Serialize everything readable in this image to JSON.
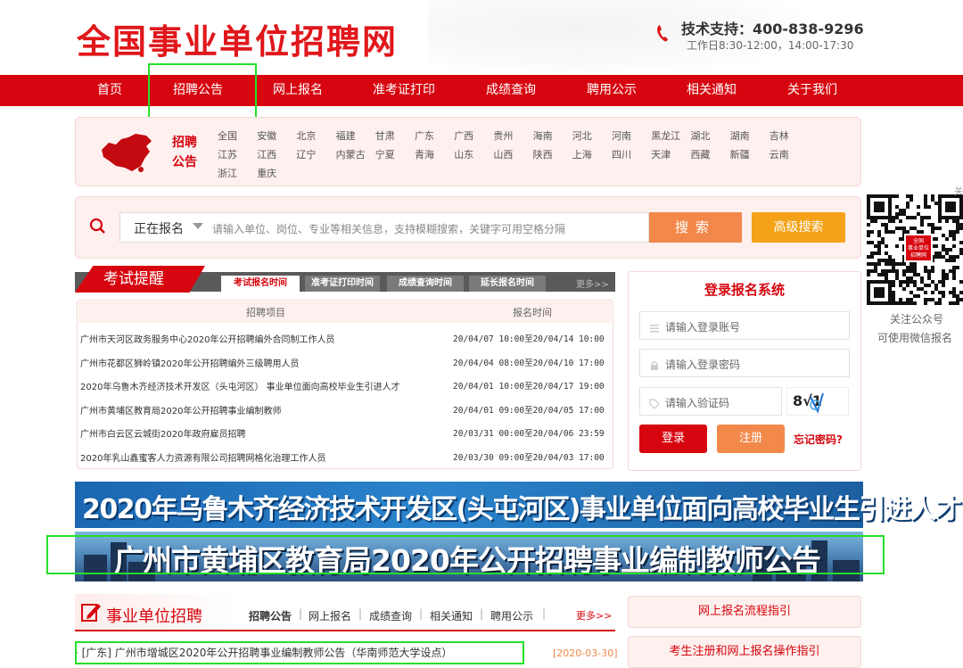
{
  "site": {
    "logo_text": "全国事业单位招聘网",
    "support": "技术支持：400-838-9296",
    "hours": "工作日8:30-12:00，14:00-17:30"
  },
  "nav": [
    "首页",
    "招聘公告",
    "网上报名",
    "准考证打印",
    "成绩查询",
    "聘用公示",
    "相关通知",
    "关于我们"
  ],
  "region": {
    "label": [
      "招聘",
      "公告"
    ],
    "provinces": [
      [
        "全国",
        "安徽",
        "北京",
        "福建",
        "甘肃",
        "广东",
        "广西",
        "贵州",
        "海南",
        "河北",
        "河南",
        "黑龙江",
        "湖北",
        "湖南",
        "吉林"
      ],
      [
        "江苏",
        "江西",
        "辽宁",
        "内蒙古",
        "宁夏",
        "青海",
        "山东",
        "山西",
        "陕西",
        "上海",
        "四川",
        "天津",
        "西藏",
        "新疆",
        "云南"
      ],
      [
        "浙江",
        "重庆"
      ]
    ]
  },
  "search": {
    "selected": "正在报名",
    "placeholder": "请输入单位、岗位、专业等相关信息，支持模糊搜索，关键字可用空格分隔",
    "search_btn": "搜索",
    "advanced_btn": "高级搜索"
  },
  "qr": {
    "caption1": "关注公众号",
    "caption2": "可使用微信报名",
    "side_text": "关",
    "badge_lines": [
      "全国",
      "事业单位",
      "招聘网"
    ]
  },
  "exam": {
    "title": "考试提醒",
    "tabs": [
      "考试报名时间",
      "准考证打印时间",
      "成绩查询时间",
      "延长报名时间"
    ],
    "more": "更多>>",
    "col_item": "招聘项目",
    "col_time": "报名时间",
    "rows": [
      {
        "name": "广州市天河区政务服务中心2020年公开招聘编外合同制工作人员",
        "time": "20/04/07 10:00至20/04/14 10:00"
      },
      {
        "name": "广州市花都区狮岭镇2020年公开招聘编外三级聘用人员",
        "time": "20/04/04 08:00至20/04/10 17:00"
      },
      {
        "name": "2020年乌鲁木齐经济技术开发区（头屯河区） 事业单位面向高校毕业生引进人才",
        "time": "20/04/01 10:00至20/04/17 19:00"
      },
      {
        "name": "广州市黄埔区教育局2020年公开招聘事业编制教师",
        "time": "20/04/01 09:00至20/04/05 17:00"
      },
      {
        "name": "广州市白云区云城街2020年政府雇员招聘",
        "time": "20/03/31 00:00至20/04/06 23:59"
      },
      {
        "name": "2020年乳山鑫蜜客人力资源有限公司招聘网格化治理工作人员",
        "time": "20/03/30 09:00至20/04/03 17:00"
      }
    ]
  },
  "login": {
    "title": "登录报名系统",
    "account_ph": "请输入登录账号",
    "password_ph": "请输入登录密码",
    "captcha_ph": "请输入验证码",
    "captcha_text": "8√1",
    "login_btn": "登录",
    "register_btn": "注册",
    "forgot": "忘记密码?"
  },
  "banners": [
    "2020年乌鲁木齐经济技术开发区(头屯河区)事业单位面向高校毕业生引进人才",
    "广州市黄埔区教育局2020年公开招聘事业编制教师公告"
  ],
  "jobs": {
    "title": "事业单位招聘",
    "tabs": [
      "招聘公告",
      "网上报名",
      "成绩查询",
      "相关通知",
      "聘用公示"
    ],
    "more": "更多>>",
    "rows": [
      {
        "text": "· [广东] 广州市增城区2020年公开招聘事业编制教师公告（华南师范大学设点）",
        "date": "[2020-03-30]"
      }
    ]
  },
  "guides": [
    "网上报名流程指引",
    "考生注册和网上报名操作指引"
  ],
  "colors": {
    "brand_red": "#d6050f",
    "orange": "#f2894a",
    "gold": "#f4a217",
    "highlight_green": "#25e02a"
  }
}
